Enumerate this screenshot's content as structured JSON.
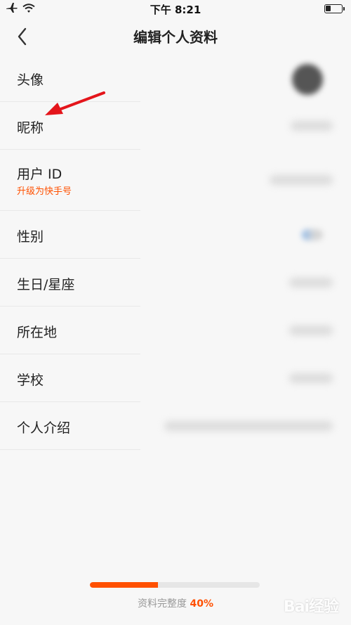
{
  "status_bar": {
    "time": "下午 8:21",
    "icons": [
      "airplane-icon",
      "wifi-icon",
      "battery-icon"
    ]
  },
  "nav": {
    "back_icon": "chevron-left-icon",
    "title": "编辑个人资料"
  },
  "rows": [
    {
      "label": "头像"
    },
    {
      "label": "昵称"
    },
    {
      "label": "用户 ID",
      "sublabel": "升级为快手号"
    },
    {
      "label": "性别"
    },
    {
      "label": "生日/星座"
    },
    {
      "label": "所在地"
    },
    {
      "label": "学校"
    },
    {
      "label": "个人介绍"
    }
  ],
  "annotation": {
    "icon": "red-arrow-icon",
    "color": "#e4151b"
  },
  "progress": {
    "label": "资料完整度",
    "value_text": "40%",
    "fraction": 0.4,
    "color": "#ff5000"
  },
  "watermark": {
    "text": "Bai经验"
  },
  "colors": {
    "accent": "#ff5000",
    "background": "#f7f7f7"
  }
}
